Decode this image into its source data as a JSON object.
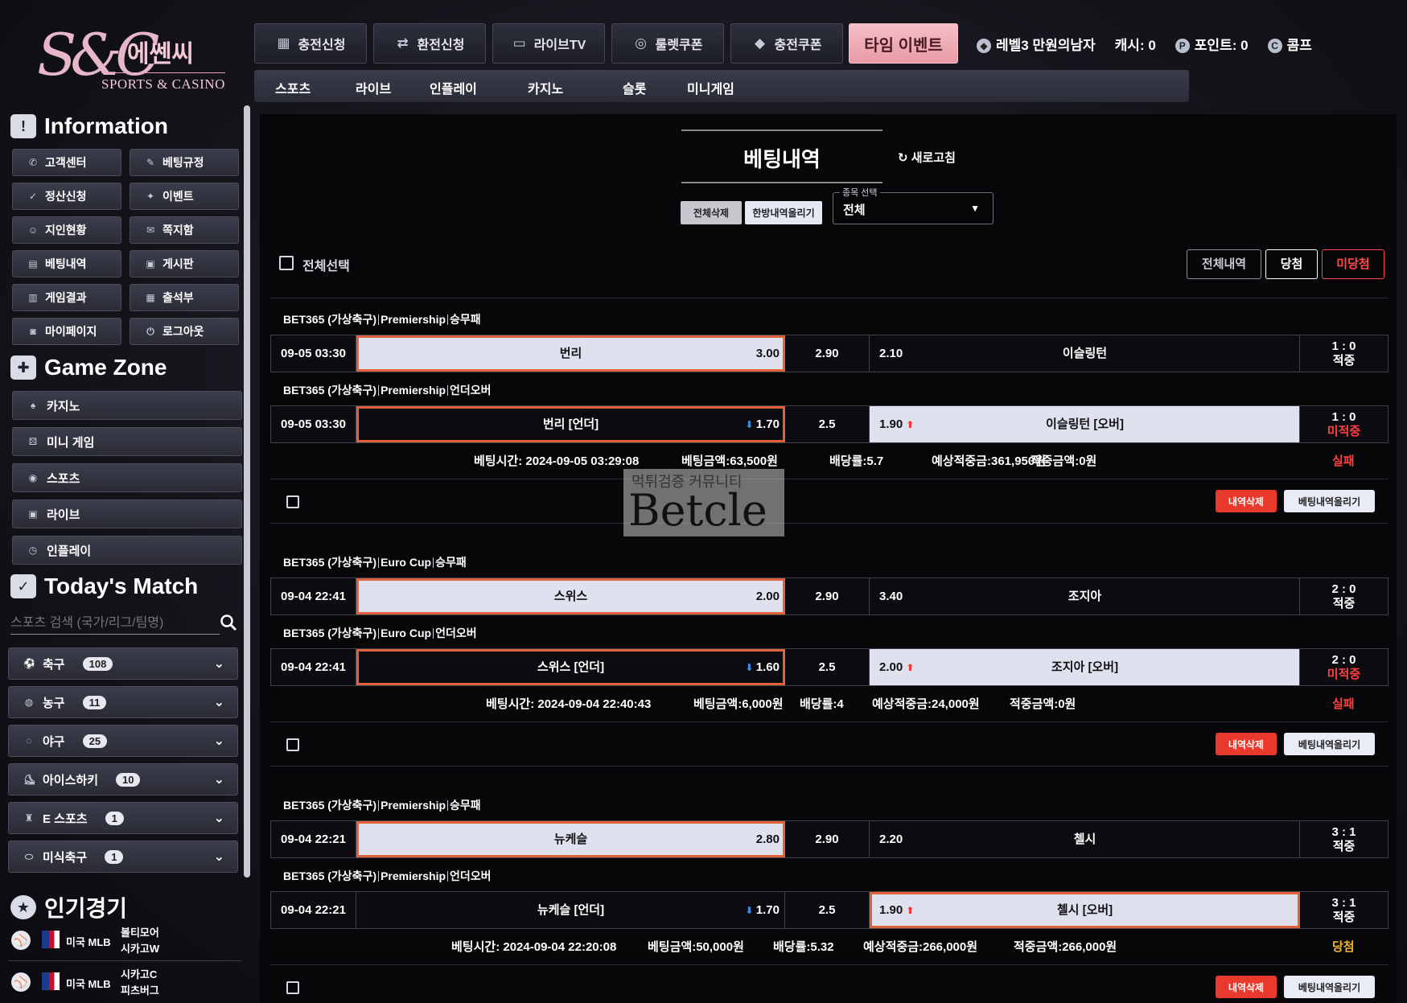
{
  "brand": {
    "mono": "S&C",
    "kr": "에쎈씨",
    "en": "SPORTS & CASINO"
  },
  "topnav": [
    {
      "label": "충전신청",
      "icon": "coins-icon"
    },
    {
      "label": "환전신청",
      "icon": "exchange-icon"
    },
    {
      "label": "라이브TV",
      "icon": "tv-icon"
    },
    {
      "label": "룰렛쿠폰",
      "icon": "roulette-icon"
    },
    {
      "label": "충전쿠폰",
      "icon": "coupon-icon"
    },
    {
      "label": "타임 이벤트",
      "icon": ""
    }
  ],
  "user": {
    "level": "레벨3 만원의남자",
    "cash": "캐시: 0",
    "point": "포인트: 0",
    "comp": "콤프"
  },
  "subnav": [
    "스포츠",
    "라이브",
    "인플레이",
    "카지노",
    "슬롯",
    "미니게임"
  ],
  "sidebar": {
    "info_title": "Information",
    "info": [
      "고객센터",
      "베팅규정",
      "정산신청",
      "이벤트",
      "지인현황",
      "쪽지함",
      "베팅내역",
      "게시판",
      "게임결과",
      "출석부",
      "마이페이지",
      "로그아웃"
    ],
    "gamezone_title": "Game Zone",
    "gamezone": [
      "카지노",
      "미니 게임",
      "스포츠",
      "라이브",
      "인플레이"
    ],
    "today_title": "Today's Match",
    "search_placeholder": "스포츠 검색 (국가/리그/팀명)",
    "categories": [
      {
        "name": "축구",
        "count": "108"
      },
      {
        "name": "농구",
        "count": "11"
      },
      {
        "name": "야구",
        "count": "25"
      },
      {
        "name": "아이스하키",
        "count": "10"
      },
      {
        "name": "E 스포츠",
        "count": "1"
      },
      {
        "name": "미식축구",
        "count": "1"
      }
    ],
    "popular_title": "인기경기",
    "popular": [
      {
        "league": "미국 MLB",
        "t1": "볼티모어",
        "t2": "시카고W"
      },
      {
        "league": "미국 MLB",
        "t1": "시카고C",
        "t2": "피츠버그"
      }
    ]
  },
  "main": {
    "title": "베팅내역",
    "refresh": "새로고침",
    "del_all": "전체삭제",
    "up_all": "한방내역올리기",
    "select_label": "종목 선택",
    "select_value": "전체",
    "select_all": "전체선택",
    "filters": {
      "all": "전체내역",
      "win": "당첨",
      "lose": "미당첨"
    },
    "btn_del": "내역삭제",
    "btn_up": "베팅내역올리기",
    "bets": [
      {
        "matches": [
          {
            "label": {
              "a": "BET365 (가상축구)",
              "b": "Premiership",
              "c": "승무패"
            },
            "date": "09-05 03:30",
            "home": "번리",
            "home_odd": "3.00",
            "mid": "2.90",
            "away_odd": "2.10",
            "away": "이슬링턴",
            "score": "1 : 0",
            "status": "적중"
          },
          {
            "label": {
              "a": "BET365 (가상축구)",
              "b": "Premiership",
              "c": "언더오버"
            },
            "date": "09-05 03:30",
            "home": "번리 [언더]",
            "home_odd": "1.70",
            "mid": "2.5",
            "away_odd": "1.90",
            "away": "이슬링턴 [오버]",
            "score": "1 : 0",
            "status": "미적중"
          }
        ],
        "time": "베팅시간: 2024-09-05 03:29:08",
        "amount": "베팅금액:63,500원",
        "rate": "배당률:5.7",
        "expected": "예상적중금:361,950원",
        "won": "적중금액:0원",
        "result": "실패"
      },
      {
        "matches": [
          {
            "label": {
              "a": "BET365 (가상축구)",
              "b": "Euro Cup",
              "c": "승무패"
            },
            "date": "09-04 22:41",
            "home": "스위스",
            "home_odd": "2.00",
            "mid": "2.90",
            "away_odd": "3.40",
            "away": "조지아",
            "score": "2 : 0",
            "status": "적중"
          },
          {
            "label": {
              "a": "BET365 (가상축구)",
              "b": "Euro Cup",
              "c": "언더오버"
            },
            "date": "09-04 22:41",
            "home": "스위스 [언더]",
            "home_odd": "1.60",
            "mid": "2.5",
            "away_odd": "2.00",
            "away": "조지아 [오버]",
            "score": "2 : 0",
            "status": "미적중"
          }
        ],
        "time": "베팅시간: 2024-09-04 22:40:43",
        "amount": "베팅금액:6,000원",
        "rate": "배당률:4",
        "expected": "예상적중금:24,000원",
        "won": "적중금액:0원",
        "result": "실패"
      },
      {
        "matches": [
          {
            "label": {
              "a": "BET365 (가상축구)",
              "b": "Premiership",
              "c": "승무패"
            },
            "date": "09-04 22:21",
            "home": "뉴케슬",
            "home_odd": "2.80",
            "mid": "2.90",
            "away_odd": "2.20",
            "away": "첼시",
            "score": "3 : 1",
            "status": "적중"
          },
          {
            "label": {
              "a": "BET365 (가상축구)",
              "b": "Premiership",
              "c": "언더오버"
            },
            "date": "09-04 22:21",
            "home": "뉴케슬 [언더]",
            "home_odd": "1.70",
            "mid": "2.5",
            "away_odd": "1.90",
            "away": "첼시 [오버]",
            "score": "3 : 1",
            "status": "적중"
          }
        ],
        "time": "베팅시간: 2024-09-04 22:20:08",
        "amount": "베팅금액:50,000원",
        "rate": "배당률:5.32",
        "expected": "예상적중금:266,000원",
        "won": "적중금액:266,000원",
        "result": "당첨"
      }
    ]
  },
  "watermark": {
    "line1": "먹튀검증 커뮤니티",
    "line2": "Betcle"
  }
}
